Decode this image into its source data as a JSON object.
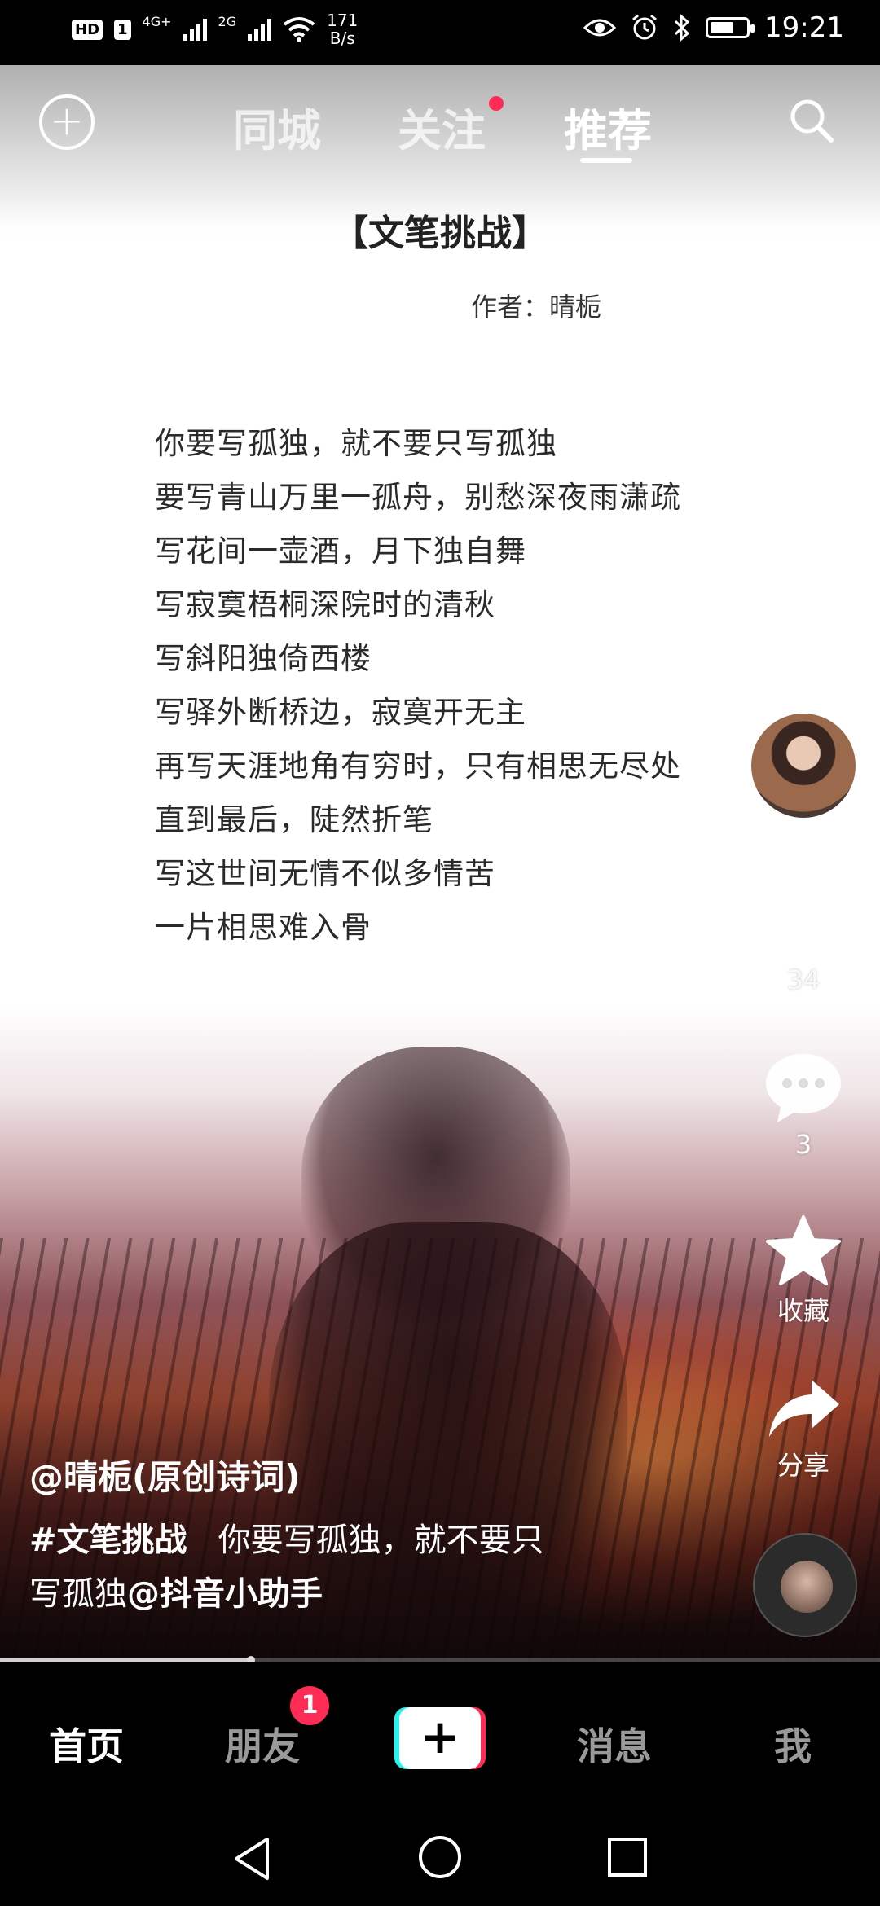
{
  "status_bar": {
    "hd": "HD",
    "sim": "1",
    "net1": "4G+",
    "net2": "2G",
    "speed_value": "171",
    "speed_unit": "B/s",
    "time": "19:21"
  },
  "top_nav": {
    "tabs": [
      {
        "label": "同城",
        "active": false
      },
      {
        "label": "关注",
        "active": false,
        "has_dot": true
      },
      {
        "label": "推荐",
        "active": true
      }
    ]
  },
  "poem": {
    "title": "【文笔挑战】",
    "author": "作者：晴栀",
    "lines": [
      "你要写孤独，就不要只写孤独",
      "要写青山万里一孤舟，别愁深夜雨潇疏",
      "写花间一壶酒，月下独自舞",
      "写寂寞梧桐深院时的清秋",
      "写斜阳独倚西楼",
      "写驿外断桥边，寂寞开无主",
      "再写天涯地角有穷时，只有相思无尽处",
      "直到最后，陡然折笔",
      "写这世间无情不似多情苦",
      "一片相思难入骨"
    ]
  },
  "actions": {
    "likes": "34",
    "comments": "3",
    "favorite_label": "收藏",
    "share_label": "分享"
  },
  "caption": {
    "author": "@晴栀(原创诗词)",
    "hashtag": "#文笔挑战",
    "text_part1": "你要写孤独，就不要只",
    "text_part2": "写孤独",
    "mention": "@抖音小助手"
  },
  "progress": {
    "fraction": 0.285
  },
  "bottom_nav": {
    "home": "首页",
    "friends": "朋友",
    "friends_badge": "1",
    "create": "+",
    "messages": "消息",
    "me": "我"
  },
  "colors": {
    "accent_red": "#fe2c55",
    "accent_cyan": "#25f4ee"
  }
}
